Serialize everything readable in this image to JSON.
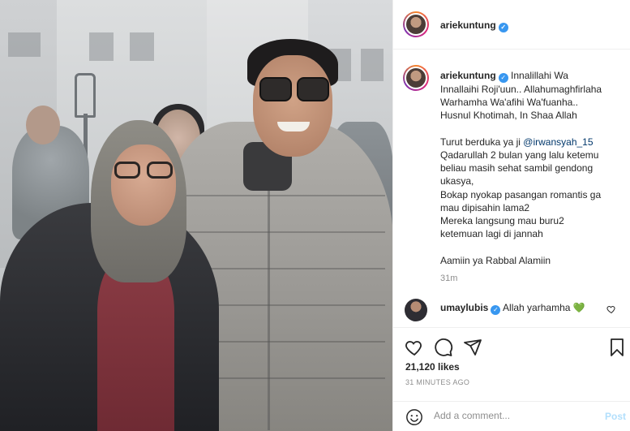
{
  "post": {
    "username": "ariekuntung",
    "caption_lines": [
      "Innalillahi Wa",
      "Innallaihi Roji'uun.. Allahumaghfirlaha",
      "Warhamha Wa'afihi Wa'fuanha..",
      "Husnul Khotimah, In Shaa Allah"
    ],
    "para2_prefix": "Turut berduka ya ji ",
    "para2_mention": "@irwansyah_15",
    "para2_lines": [
      "Qadarullah 2 bulan yang lalu ketemu",
      "beliau masih sehat sambil gendong",
      "ukasya,",
      "Bokap nyokap pasangan romantis ga",
      "mau dipisahin lama2",
      "Mereka langsung mau buru2",
      "ketemuan lagi di jannah"
    ],
    "para3": "Aamiin ya Rabbal Alamiin",
    "caption_time": "31m",
    "likes": "21,120 likes",
    "posted_ago": "31 MINUTES AGO"
  },
  "comment": {
    "username": "umaylubis",
    "text": "Allah yarhamha",
    "emoji": "💚"
  },
  "composer": {
    "placeholder": "Add a comment...",
    "post_label": "Post"
  },
  "icons": {
    "verified": "verified-badge-icon",
    "like": "heart-icon",
    "comment": "comment-bubble-icon",
    "share": "paper-plane-icon",
    "save": "bookmark-icon",
    "emoji": "smiley-icon"
  },
  "colors": {
    "verified_blue": "#3897f0",
    "mention": "#00376b",
    "post_disabled": "#b2dffc",
    "muted": "#8e8e8e"
  }
}
